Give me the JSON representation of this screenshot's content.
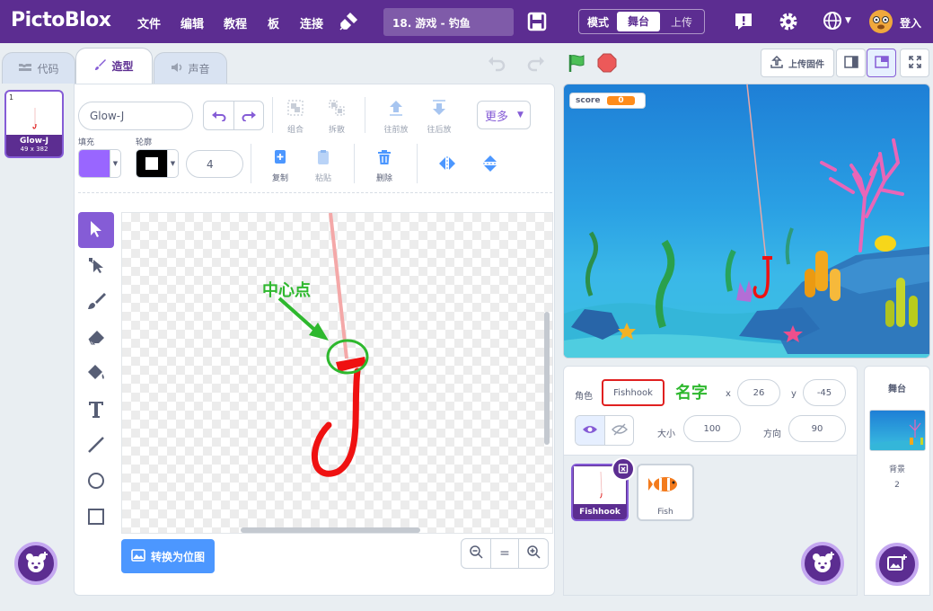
{
  "menubar": {
    "logo": "PictoBlox",
    "file": "文件",
    "edit": "编辑",
    "tutorial": "教程",
    "board": "板",
    "connect": "连接",
    "project_title": "18. 游戏 - 钓鱼",
    "mode_label": "模式",
    "mode_stage": "舞台",
    "mode_upload": "上传",
    "login": "登入"
  },
  "tabs": {
    "code": "代码",
    "costumes": "造型",
    "sounds": "声音"
  },
  "costume_list": [
    {
      "index": "1",
      "name": "Glow-J",
      "size": "49 x 382"
    }
  ],
  "paint_editor": {
    "costume_name": "Glow-J",
    "fill_label": "填充",
    "outline_label": "轮廓",
    "outline_width": "4",
    "group": "组合",
    "ungroup": "拆散",
    "forward": "往前放",
    "backward": "往后放",
    "more": "更多",
    "copy": "复制",
    "paste": "粘贴",
    "delete": "删除",
    "convert_bitmap": "转换为位图",
    "fill_color": "#9966ff",
    "outline_color": "#000000"
  },
  "annotations": {
    "center_point": "中心点",
    "name_label": "名字"
  },
  "stage_header": {
    "upload_firmware": "上传固件"
  },
  "stage": {
    "score_label": "score",
    "score_value": "0"
  },
  "sprite_info": {
    "sprite_label": "角色",
    "sprite_name": "Fishhook",
    "x_label": "x",
    "x_value": "26",
    "y_label": "y",
    "y_value": "-45",
    "size_label": "大小",
    "size_value": "100",
    "direction_label": "方向",
    "direction_value": "90"
  },
  "sprites": [
    {
      "name": "Fishhook",
      "selected": true
    },
    {
      "name": "Fish",
      "selected": false
    }
  ],
  "stage_target": {
    "title": "舞台",
    "backdrop_label": "背景",
    "backdrop_count": "2"
  },
  "colors": {
    "brand": "#5c2d91",
    "accent": "#855cd6",
    "blue": "#4c97ff",
    "annotation_green": "#2eb82e",
    "annotation_red": "#e02020"
  }
}
